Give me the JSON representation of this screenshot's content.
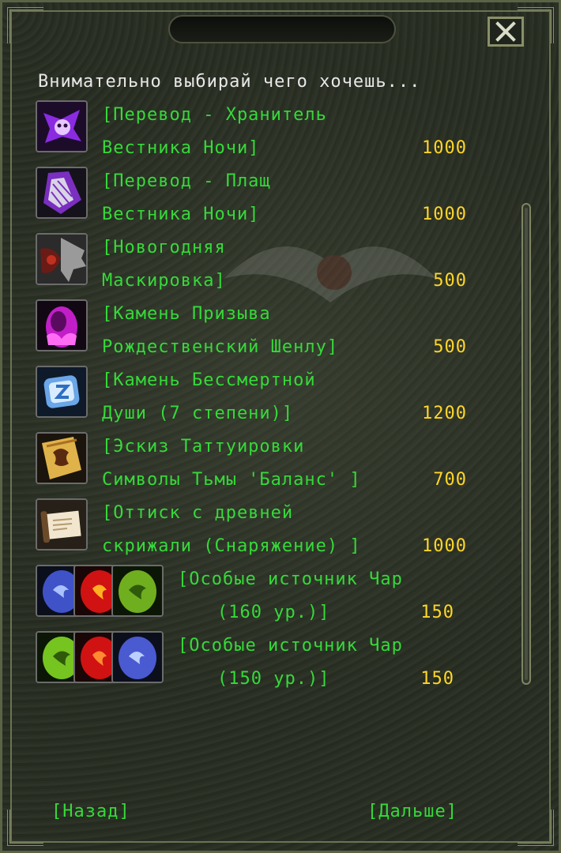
{
  "dialog": {
    "heading": "Внимательно выбирай чего хочешь...",
    "close_icon": "close-icon"
  },
  "items": [
    {
      "line1": "[Перевод - Хранитель",
      "line2": "Вестника Ночи]",
      "price": "1000",
      "icons": [
        "purple-mask-icon"
      ]
    },
    {
      "line1": "[Перевод - Плащ",
      "line2": "Вестника Ночи]",
      "price": "1000",
      "icons": [
        "cloak-icon"
      ]
    },
    {
      "line1": "[Новогодняя",
      "line2": "Маскировка]",
      "price": "500",
      "icons": [
        "winged-mask-icon"
      ]
    },
    {
      "line1": "[Камень Призыва",
      "line2": "Рождественский Шенлу]",
      "price": "500",
      "icons": [
        "pink-egg-icon"
      ]
    },
    {
      "line1": "[Камень Бессмертной",
      "line2": "Души (7 степени)]",
      "price": "1200",
      "icons": [
        "blue-crystal-icon"
      ]
    },
    {
      "line1": "[Эскиз Таттуировки",
      "line2": "Символы Тьмы 'Баланс' ]",
      "price": "700",
      "icons": [
        "tattoo-sketch-icon"
      ]
    },
    {
      "line1": "[Оттиск с древней",
      "line2": "скрижали (Снаряжение) ]",
      "price": "1000",
      "icons": [
        "scroll-icon"
      ]
    },
    {
      "line1": "[Особые источник Чар",
      "line2": "(160 ур.)]",
      "price": "150",
      "icons": [
        "blue-orb-icon",
        "red-orb-icon",
        "green-orb-icon"
      ]
    },
    {
      "line1": "[Особые источник Чар",
      "line2": "(150 ур.)]",
      "price": "150",
      "icons": [
        "green-orb-icon",
        "red-orb-icon",
        "blue-orb-icon"
      ]
    }
  ],
  "nav": {
    "back_label": "[Назад]",
    "next_label": "[Дальше]"
  },
  "colors": {
    "item_text": "#36d93a",
    "price_text": "#ffd629",
    "heading_text": "#e8e8e8"
  }
}
